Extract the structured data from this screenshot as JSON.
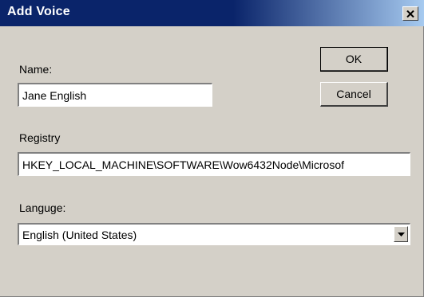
{
  "dialog": {
    "title": "Add Voice",
    "close_icon": "close-icon"
  },
  "name": {
    "label": "Name:",
    "value": "Jane English"
  },
  "buttons": {
    "ok_label": "OK",
    "cancel_label": "Cancel"
  },
  "registry": {
    "label": "Registry",
    "value": "HKEY_LOCAL_MACHINE\\SOFTWARE\\Wow6432Node\\Microsof"
  },
  "language": {
    "label": "Languge:",
    "selected": "English (United States)",
    "arrow_icon": "chevron-down-icon"
  },
  "colors": {
    "titlebar": "#0a246a",
    "face": "#d4d0c8"
  }
}
